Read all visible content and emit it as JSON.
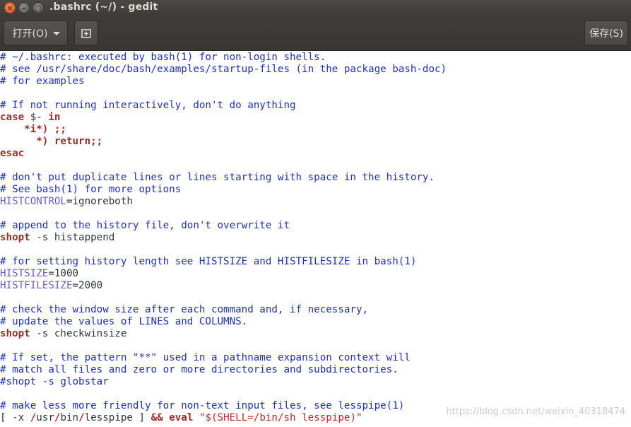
{
  "window": {
    "title": ".bashrc (~/) - gedit",
    "close_glyph": "×",
    "minimize_glyph": "−",
    "maximize_glyph": "□"
  },
  "toolbar": {
    "open_label": "打开(O)",
    "new_tab_icon": "new-document-icon",
    "save_label": "保存(S)"
  },
  "editor": {
    "lines": [
      [
        {
          "t": "cm",
          "v": "# ~/.bashrc: executed by bash(1) for non-login shells."
        }
      ],
      [
        {
          "t": "cm",
          "v": "# see /usr/share/doc/bash/examples/startup-files (in the package bash-doc)"
        }
      ],
      [
        {
          "t": "cm",
          "v": "# for examples"
        }
      ],
      [],
      [
        {
          "t": "cm",
          "v": "# If not running interactively, don't do anything"
        }
      ],
      [
        {
          "t": "kw",
          "v": "case"
        },
        {
          "t": "plain",
          "v": " $- "
        },
        {
          "t": "kw",
          "v": "in"
        }
      ],
      [
        {
          "t": "plain",
          "v": "    "
        },
        {
          "t": "op",
          "v": "*i*) ;;"
        }
      ],
      [
        {
          "t": "plain",
          "v": "      "
        },
        {
          "t": "op",
          "v": "*) "
        },
        {
          "t": "kw",
          "v": "return"
        },
        {
          "t": "op",
          "v": ";;"
        }
      ],
      [
        {
          "t": "kw",
          "v": "esac"
        }
      ],
      [],
      [
        {
          "t": "cm",
          "v": "# don't put duplicate lines or lines starting with space in the history."
        }
      ],
      [
        {
          "t": "cm",
          "v": "# See bash(1) for more options"
        }
      ],
      [
        {
          "t": "var",
          "v": "HISTCONTROL"
        },
        {
          "t": "plain",
          "v": "=ignoreboth"
        }
      ],
      [],
      [
        {
          "t": "cm",
          "v": "# append to the history file, don't overwrite it"
        }
      ],
      [
        {
          "t": "kw",
          "v": "shopt"
        },
        {
          "t": "plain",
          "v": " -s histappend"
        }
      ],
      [],
      [
        {
          "t": "cm",
          "v": "# for setting history length see HISTSIZE and HISTFILESIZE in bash(1)"
        }
      ],
      [
        {
          "t": "var",
          "v": "HISTSIZE"
        },
        {
          "t": "plain",
          "v": "=1000"
        }
      ],
      [
        {
          "t": "var",
          "v": "HISTFILESIZE"
        },
        {
          "t": "plain",
          "v": "=2000"
        }
      ],
      [],
      [
        {
          "t": "cm",
          "v": "# check the window size after each command and, if necessary,"
        }
      ],
      [
        {
          "t": "cm",
          "v": "# update the values of LINES and COLUMNS."
        }
      ],
      [
        {
          "t": "kw",
          "v": "shopt"
        },
        {
          "t": "plain",
          "v": " -s checkwinsize"
        }
      ],
      [],
      [
        {
          "t": "cm",
          "v": "# If set, the pattern \"**\" used in a pathname expansion context will"
        }
      ],
      [
        {
          "t": "cm",
          "v": "# match all files and zero or more directories and subdirectories."
        }
      ],
      [
        {
          "t": "cm",
          "v": "#shopt -s globstar"
        }
      ],
      [],
      [
        {
          "t": "cm",
          "v": "# make less more friendly for non-text input files, see lesspipe(1)"
        }
      ],
      [
        {
          "t": "plain",
          "v": "[ -x "
        },
        {
          "t": "op",
          "v": "/"
        },
        {
          "t": "plain",
          "v": "usr"
        },
        {
          "t": "op",
          "v": "/"
        },
        {
          "t": "plain",
          "v": "bin"
        },
        {
          "t": "op",
          "v": "/"
        },
        {
          "t": "plain",
          "v": "lesspipe ] "
        },
        {
          "t": "op",
          "v": "&&"
        },
        {
          "t": "plain",
          "v": " "
        },
        {
          "t": "kw",
          "v": "eval"
        },
        {
          "t": "plain",
          "v": " "
        },
        {
          "t": "str",
          "v": "\"$(SHELL=/bin/sh lesspipe)\""
        }
      ]
    ]
  },
  "watermark": "https://blog.csdn.net/weixin_40318474",
  "colors": {
    "comment": "#1f2ec4",
    "keyword": "#a52a2a",
    "variable": "#6a5acd",
    "string": "#c0272d"
  }
}
